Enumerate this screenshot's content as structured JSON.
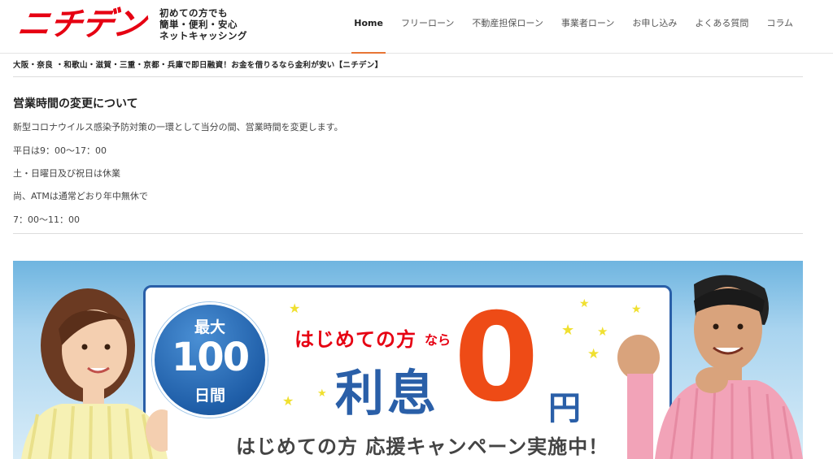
{
  "header": {
    "logo": "ニチデン",
    "tagline": [
      "初めての方でも",
      "簡単・便利・安心",
      "ネットキャッシング"
    ],
    "nav": [
      {
        "label": "Home",
        "active": true
      },
      {
        "label": "フリーローン",
        "active": false
      },
      {
        "label": "不動産担保ローン",
        "active": false
      },
      {
        "label": "事業者ローン",
        "active": false
      },
      {
        "label": "お申し込み",
        "active": false
      },
      {
        "label": "よくある質問",
        "active": false
      },
      {
        "label": "コラム",
        "active": false
      }
    ]
  },
  "breadcrumb": "大阪・奈良 ・和歌山・滋賀・三重・京都・兵庫で即日融資！お金を借りるなら金利が安い【ニチデン】",
  "notice": {
    "title": "営業時間の変更について",
    "lines": [
      "新型コロナウイルス感染予防対策の一環として当分の間、営業時間を変更します。",
      "平日は9：00〜17：00",
      "土・日曜日及び祝日は休業",
      "尚、ATMは通常どおり年中無休で",
      "7：00〜11：00"
    ]
  },
  "banner": {
    "badge_top": "最大",
    "badge_num": "100",
    "badge_bottom": "日間",
    "headline_a": "はじめての方",
    "headline_b": "なら",
    "risoku": "利息",
    "zero": "0",
    "en": "円",
    "campaign": "はじめての方 応援キャンペーン実施中！"
  },
  "colors": {
    "brand_red": "#e60012",
    "nav_active_underline": "#e87535",
    "banner_blue": "#2a5fa8",
    "zero_orange": "#ee4b16"
  }
}
